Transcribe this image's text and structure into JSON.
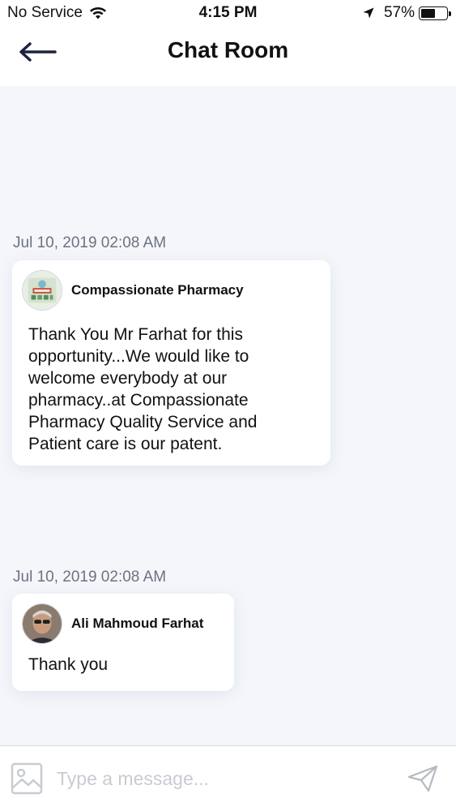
{
  "status_bar": {
    "carrier": "No Service",
    "time": "4:15 PM",
    "battery_percent": "57%",
    "battery_level": 0.57,
    "icons": [
      "wifi-icon",
      "location-arrow-icon",
      "battery-icon"
    ]
  },
  "header": {
    "title": "Chat Room",
    "back_icon": "arrow-left-icon"
  },
  "messages": [
    {
      "timestamp": "Jul 10, 2019 02:08 AM",
      "sender": "Compassionate Pharmacy",
      "text": "Thank You Mr Farhat for this\nopportunity...We would like to\nwelcome everybody at our\npharmacy..at Compassionate\nPharmacy Quality Service and\nPatient care is our patent."
    },
    {
      "timestamp": "Jul 10, 2019 02:08 AM",
      "sender": "Ali Mahmoud Farhat",
      "text": "Thank you"
    }
  ],
  "input_bar": {
    "placeholder": "Type a message...",
    "value": "",
    "image_icon": "image-icon",
    "send_icon": "send-icon"
  },
  "colors": {
    "chat_background": "#f4f6fa",
    "timestamp_text": "#6b7380",
    "placeholder_text": "#c8ccd2",
    "header_arrow": "#1c2340"
  }
}
